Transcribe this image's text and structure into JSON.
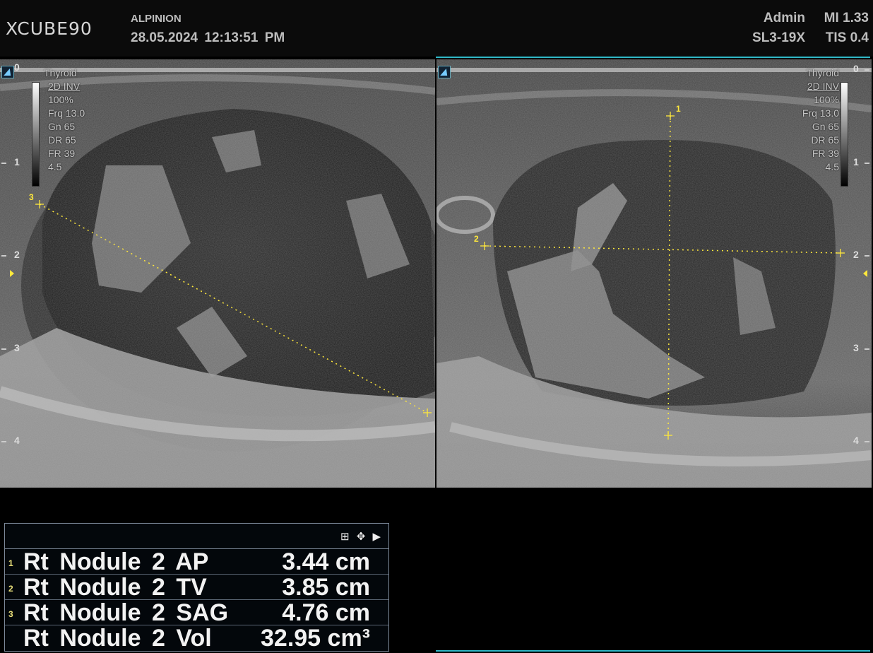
{
  "header": {
    "logo": "XCUBE90",
    "hospital": "ALPINION",
    "datetime": "28.05.2024  12:13:51 PM",
    "user": "Admin",
    "mi": "MI 1.33",
    "probe": "SL3-19X",
    "tis": "TIS 0.4"
  },
  "left_image": {
    "preset": "Thyroid",
    "mode": "2D INV",
    "power": "100%",
    "frequency": "Frq 13.0",
    "gain": "Gn",
    "gain_value": "65",
    "dynamic_range": "DR",
    "dynamic_range_value": "65",
    "frame_rate": "FR",
    "frame_rate_value": "39",
    "depth_value": "4.5",
    "calipers": [
      "3"
    ],
    "depth_scale": [
      "0",
      "1",
      "2",
      "3",
      "4"
    ]
  },
  "right_image": {
    "preset": "Thyroid",
    "mode": "2D INV",
    "power": "100%",
    "frequency": "Frq 13.0",
    "gain": "Gn 65",
    "dynamic_range": "DR 65",
    "frame_rate": "FR 39",
    "depth_value": "4.5",
    "calipers": [
      "1",
      "2"
    ],
    "depth_scale": [
      "0",
      "1",
      "2",
      "3",
      "4"
    ]
  },
  "measurement_controls": "⊞ ✥ ▶",
  "measurements": [
    {
      "index": "1",
      "name": "Rt  Nodule 2 AP",
      "value": "3.44 cm"
    },
    {
      "index": "2",
      "name": "Rt  Nodule 2 TV",
      "value": "3.85 cm"
    },
    {
      "index": "3",
      "name": "Rt  Nodule 2 SAG",
      "value": "4.76 cm"
    },
    {
      "index": "",
      "name": "Rt  Nodule 2 Vol",
      "value": "32.95 cm³"
    }
  ],
  "colors": {
    "caliper": "#ffe83c",
    "active_border": "#2fb7c6"
  }
}
